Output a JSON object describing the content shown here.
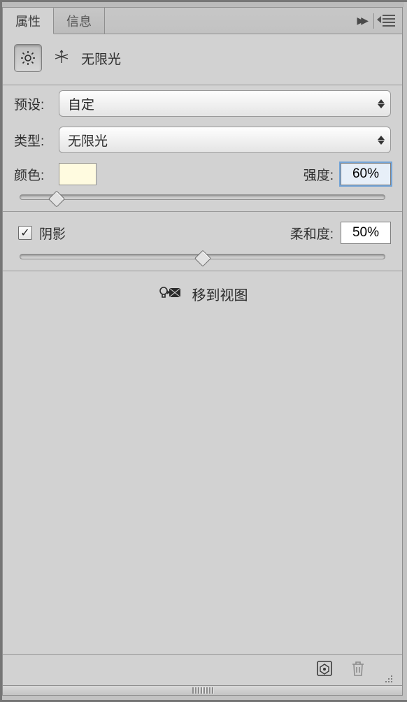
{
  "tabs": {
    "active": "属性",
    "inactive": "信息"
  },
  "header": {
    "title": "无限光"
  },
  "preset": {
    "label": "预设:",
    "value": "自定"
  },
  "type": {
    "label": "类型:",
    "value": "无限光"
  },
  "color": {
    "label": "颜色:",
    "swatch_hex": "#fffbe0"
  },
  "intensity": {
    "label": "强度:",
    "value": "60%",
    "pct": 10
  },
  "shadow": {
    "checkbox_label": "阴影",
    "checked": true
  },
  "softness": {
    "label": "柔和度:",
    "value": "50%",
    "pct": 50
  },
  "action": {
    "label": "移到视图"
  }
}
